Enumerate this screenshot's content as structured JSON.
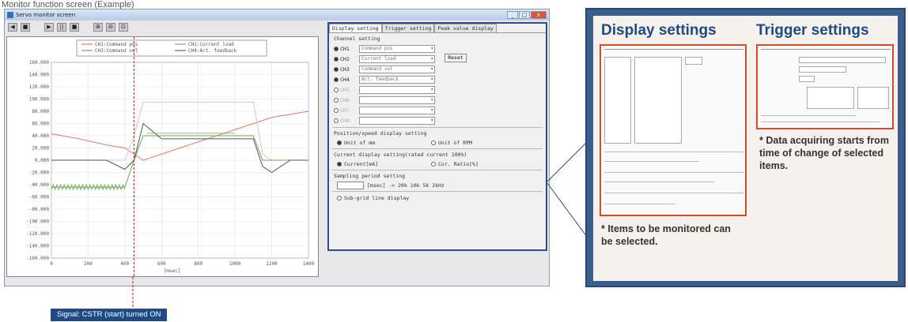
{
  "caption": "Monitor function screen (Example)",
  "window": {
    "title": "Servo monitor screen",
    "minimize": "_",
    "maximize": "□",
    "close": "x"
  },
  "toolbar": {
    "buttons": [
      "◀",
      "■",
      "▶",
      "||",
      "■",
      "⊞",
      "⊟",
      "⊡"
    ]
  },
  "chart": {
    "legend": [
      {
        "label": "CH1:Command pos",
        "color": "#e07a5f"
      },
      {
        "label": "CH2:Current load",
        "color": "#999999"
      },
      {
        "label": "CH3:Command vel",
        "color": "#6aa84f"
      },
      {
        "label": "CH4:Act. feedback",
        "color": "#666666"
      }
    ],
    "x_unit": "[msec]",
    "x_ticks": [
      "0",
      "200",
      "400",
      "600",
      "800",
      "1000",
      "1200",
      "1400"
    ],
    "y_ticks": [
      "160.000",
      "140.000",
      "120.000",
      "100.000",
      "80.000",
      "60.000",
      "40.000",
      "20.000",
      "0.000",
      "-20.000",
      "-40.000",
      "-60.000",
      "-80.000",
      "-100.000",
      "-120.000",
      "-140.000",
      "-160.000"
    ]
  },
  "chart_data": {
    "type": "line",
    "xlabel": "[msec]",
    "x": [
      0,
      150,
      300,
      400,
      450,
      500,
      600,
      800,
      1000,
      1100,
      1150,
      1200,
      1300,
      1400
    ],
    "xlim": [
      0,
      1400
    ],
    "ylim": [
      -160,
      160
    ],
    "series": [
      {
        "name": "CH1:Command pos",
        "color": "#e07a5f",
        "values": [
          43,
          35,
          25,
          20,
          10,
          0,
          10,
          30,
          50,
          60,
          65,
          70,
          75,
          80
        ]
      },
      {
        "name": "CH2:Current load",
        "color": "#cccccc",
        "values": [
          0,
          0,
          0,
          0,
          40,
          95,
          95,
          95,
          95,
          95,
          10,
          0,
          0,
          0
        ]
      },
      {
        "name": "CH3:Command vel",
        "color": "#6aa84f",
        "values": [
          -44,
          -44,
          -44,
          -44,
          0,
          40,
          40,
          40,
          40,
          40,
          0,
          0,
          0,
          0
        ]
      },
      {
        "name": "CH4:Act. feedback",
        "color": "#555555",
        "values": [
          0,
          0,
          0,
          -15,
          0,
          60,
          35,
          35,
          35,
          35,
          -10,
          -20,
          0,
          0
        ]
      }
    ],
    "grid": true
  },
  "settings": {
    "tabs": [
      "Display setting",
      "Trigger setting",
      "Peak value display"
    ],
    "channel_setting": "Channel setting",
    "reset": "Reset",
    "channels": [
      {
        "label": "CH1",
        "value": "Command pos",
        "enabled": true
      },
      {
        "label": "CH2",
        "value": "Current load",
        "enabled": true
      },
      {
        "label": "CH3",
        "value": "Command vel",
        "enabled": true
      },
      {
        "label": "CH4",
        "value": "Act. feedback",
        "enabled": true
      },
      {
        "label": "CH5",
        "value": "",
        "enabled": false
      },
      {
        "label": "CH6",
        "value": "",
        "enabled": false
      },
      {
        "label": "CH7",
        "value": "",
        "enabled": false
      },
      {
        "label": "CH8",
        "value": "",
        "enabled": false
      }
    ],
    "position_display": "Position/speed display setting",
    "unit_mm": "Unit of mm",
    "unit_rpm": "Unit of RPM",
    "current_display": "Current display setting(rated current 100%)",
    "current_ma": "Current[mA]",
    "current_ratio": "Cur. Ratio[%]",
    "sampling": "Sampling period setting",
    "sampling_text": "[msec] -> 20k 10k 5k 2kHz",
    "subgrid": "Sub-grid line display"
  },
  "callout": {
    "display_heading": "Display settings",
    "trigger_heading": "Trigger settings",
    "note_display": "* Items to be monitored can be selected.",
    "note_trigger": "* Data acquiring starts from time of change of selected items."
  },
  "signal": "Signal: CSTR (start) turned ON"
}
